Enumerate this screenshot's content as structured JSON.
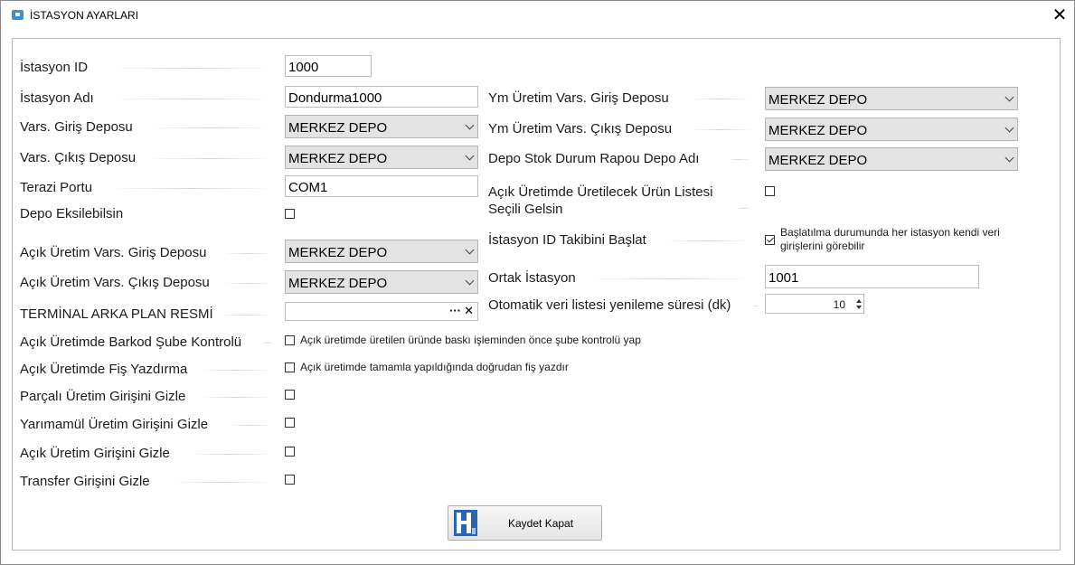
{
  "window": {
    "title": "İSTASYON AYARLARI",
    "close_glyph": "✕"
  },
  "left": {
    "istasyon_id_label": "İstasyon ID",
    "istasyon_id_value": "1000",
    "istasyon_adi_label": "İstasyon Adı",
    "istasyon_adi_value": "Dondurma1000",
    "vars_giris_label": "Vars. Giriş Deposu",
    "vars_giris_value": "MERKEZ DEPO",
    "vars_cikis_label": "Vars. Çıkış Deposu",
    "vars_cikis_value": "MERKEZ DEPO",
    "terazi_label": "Terazi Portu",
    "terazi_value": "COM1",
    "depo_eksi_label": "Depo Eksilebilsin",
    "acik_giris_label": "Açık Üretim Vars. Giriş Deposu",
    "acik_giris_value": "MERKEZ DEPO",
    "acik_cikis_label": "Açık Üretim Vars. Çıkış Deposu",
    "acik_cikis_value": "MERKEZ DEPO",
    "terminal_resim_label": "TERMİNAL ARKA PLAN RESMİ",
    "terminal_browse": "···",
    "terminal_clear": "✕",
    "barkod_label": "Açık Üretimde Barkod Şube Kontrolü",
    "barkod_cb_text": "Açık üretimde üretilen üründe baskı işleminden önce şube kontrolü yap",
    "fis_label": "Açık Üretimde Fiş Yazdırma",
    "fis_cb_text": "Açık üretimde tamamla yapıldığında doğrudan fiş yazdır",
    "parcali_label": "Parçalı Üretim Girişini Gizle",
    "yari_label": "Yarımamül Üretim Girişini Gizle",
    "acik_gizle_label": "Açık Üretim Girişini Gizle",
    "transfer_label": "Transfer Girişini Gizle"
  },
  "right": {
    "ym_giris_label": "Ym Üretim Vars. Giriş Deposu",
    "ym_giris_value": "MERKEZ DEPO",
    "ym_cikis_label": "Ym Üretim Vars. Çıkış Deposu",
    "ym_cikis_value": "MERKEZ DEPO",
    "rapor_label": "Depo Stok Durum Rapou Depo Adı",
    "rapor_value": "MERKEZ DEPO",
    "urun_listesi_label": "Açık Üretimde Üretilecek Ürün Listesi Seçili Gelsin",
    "takip_label": "İstasyon ID Takibini Başlat",
    "takip_note": "Başlatılma durumunda her istasyon kendi veri girişlerini görebilir",
    "takip_checked": true,
    "ortak_label": "Ortak İstasyon",
    "ortak_value": "1001",
    "yenileme_label": "Otomatik veri listesi yenileme süresi (dk)",
    "yenileme_value": "10"
  },
  "buttons": {
    "save_label": "Kaydet Kapat"
  },
  "colors": {
    "accent": "#1f6fc5",
    "combo_bg": "#e3e3e3",
    "border": "#bdbdbd"
  }
}
